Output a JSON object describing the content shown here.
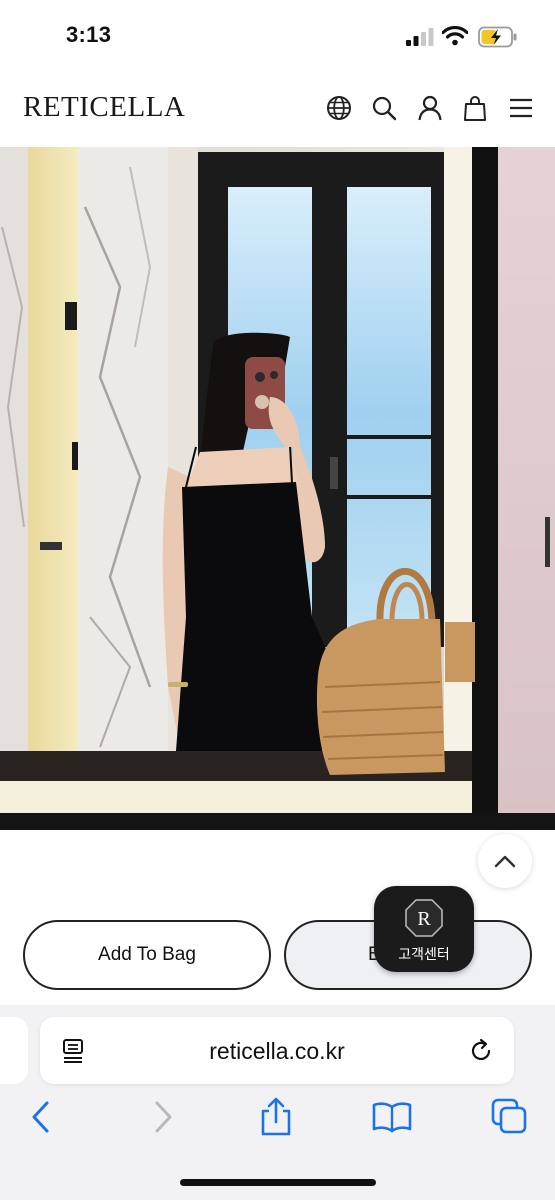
{
  "status": {
    "time": "3:13"
  },
  "header": {
    "brand": "RETICELLA"
  },
  "product": {
    "add_to_bag_label": "Add To Bag",
    "buy_now_label_visible": "B"
  },
  "customer_service": {
    "badge_letter": "R",
    "label": "고객센터"
  },
  "browser": {
    "url": "reticella.co.kr"
  }
}
